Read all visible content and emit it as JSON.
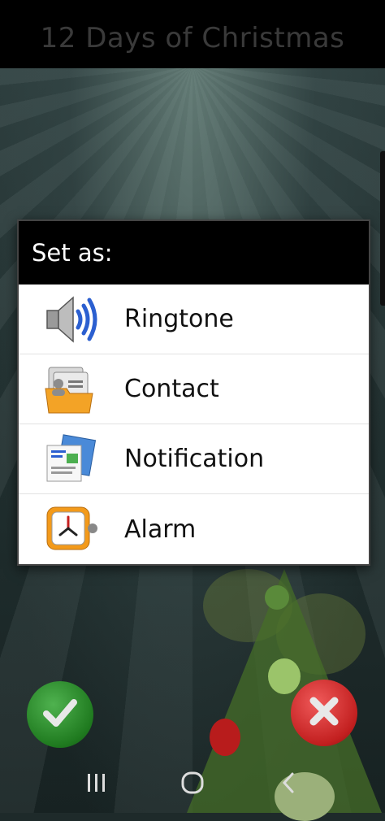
{
  "app": {
    "title": "12 Days of Christmas"
  },
  "dialog": {
    "title": "Set as:",
    "options": [
      {
        "label": "Ringtone",
        "icon": "speaker-icon"
      },
      {
        "label": "Contact",
        "icon": "contact-folder-icon"
      },
      {
        "label": "Notification",
        "icon": "notification-pictures-icon"
      },
      {
        "label": "Alarm",
        "icon": "alarm-clock-icon"
      }
    ]
  },
  "actions": {
    "confirm_icon": "checkmark-icon",
    "cancel_icon": "close-x-icon"
  },
  "system_nav": {
    "recents_icon": "recents-icon",
    "home_icon": "home-icon",
    "back_icon": "back-icon"
  },
  "colors": {
    "confirm": "#2e9a2e",
    "cancel": "#d42a2a",
    "dialog_header": "#000000"
  }
}
